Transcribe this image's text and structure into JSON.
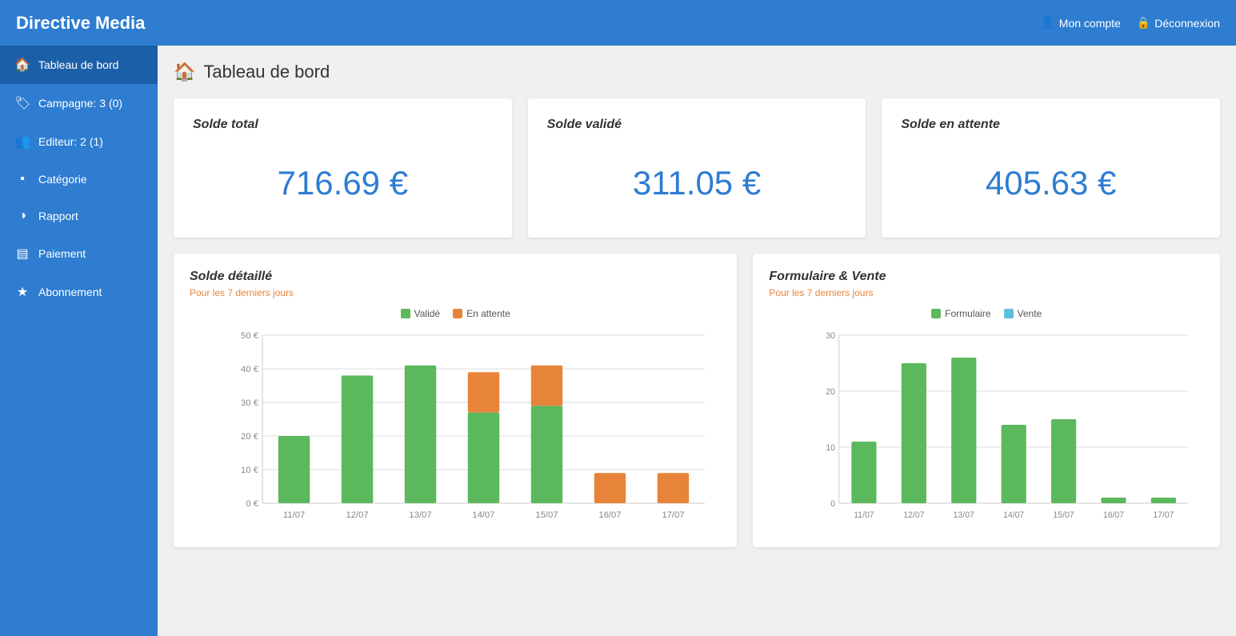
{
  "header": {
    "title": "Directive Media",
    "nav": {
      "account_label": "Mon compte",
      "logout_label": "Déconnexion"
    }
  },
  "sidebar": {
    "items": [
      {
        "id": "tableau-de-bord",
        "label": "Tableau de bord",
        "icon": "🏠",
        "active": true
      },
      {
        "id": "campagne",
        "label": "Campagne: 3 (0)",
        "icon": "🏷",
        "active": false
      },
      {
        "id": "editeur",
        "label": "Editeur: 2 (1)",
        "icon": "👥",
        "active": false
      },
      {
        "id": "categorie",
        "label": "Catégorie",
        "icon": "▪",
        "active": false
      },
      {
        "id": "rapport",
        "label": "Rapport",
        "icon": "◑",
        "active": false
      },
      {
        "id": "paiement",
        "label": "Paiement",
        "icon": "▤",
        "active": false
      },
      {
        "id": "abonnement",
        "label": "Abonnement",
        "icon": "★",
        "active": false
      }
    ]
  },
  "page": {
    "title": "Tableau de bord"
  },
  "cards": [
    {
      "id": "solde-total",
      "label": "Solde total",
      "value": "716.69 €"
    },
    {
      "id": "solde-valide",
      "label": "Solde validé",
      "value": "311.05 €"
    },
    {
      "id": "solde-attente",
      "label": "Solde en attente",
      "value": "405.63 €"
    }
  ],
  "chart1": {
    "title": "Solde détaillé",
    "subtitle": "Pour les 7 derniers jours",
    "legend": [
      {
        "label": "Validé",
        "color": "#5cb85c"
      },
      {
        "label": "En attente",
        "color": "#e8843a"
      }
    ],
    "yLabels": [
      "50 €",
      "40 €",
      "30 €",
      "20 €",
      "10 €",
      "0 €"
    ],
    "maxValue": 50,
    "bars": [
      {
        "date": "11/07",
        "valide": 20,
        "attente": 0
      },
      {
        "date": "12/07",
        "valide": 38,
        "attente": 0
      },
      {
        "date": "13/07",
        "valide": 41,
        "attente": 0
      },
      {
        "date": "14/07",
        "valide": 27,
        "attente": 12
      },
      {
        "date": "15/07",
        "valide": 29,
        "attente": 12
      },
      {
        "date": "16/07",
        "valide": 0,
        "attente": 9
      },
      {
        "date": "17/07",
        "valide": 0,
        "attente": 9
      }
    ]
  },
  "chart2": {
    "title": "Formulaire & Vente",
    "subtitle": "Pour les 7 derniers jours",
    "legend": [
      {
        "label": "Formulaire",
        "color": "#5cb85c"
      },
      {
        "label": "Vente",
        "color": "#5bc0de"
      }
    ],
    "yLabels": [
      "30",
      "20",
      "10",
      "0"
    ],
    "maxValue": 30,
    "bars": [
      {
        "date": "11/07",
        "formulaire": 11,
        "vente": 0
      },
      {
        "date": "12/07",
        "formulaire": 25,
        "vente": 0
      },
      {
        "date": "13/07",
        "formulaire": 26,
        "vente": 0
      },
      {
        "date": "14/07",
        "formulaire": 14,
        "vente": 0
      },
      {
        "date": "15/07",
        "formulaire": 15,
        "vente": 0
      },
      {
        "date": "16/07",
        "formulaire": 1,
        "vente": 0
      },
      {
        "date": "17/07",
        "formulaire": 1,
        "vente": 0
      }
    ]
  }
}
